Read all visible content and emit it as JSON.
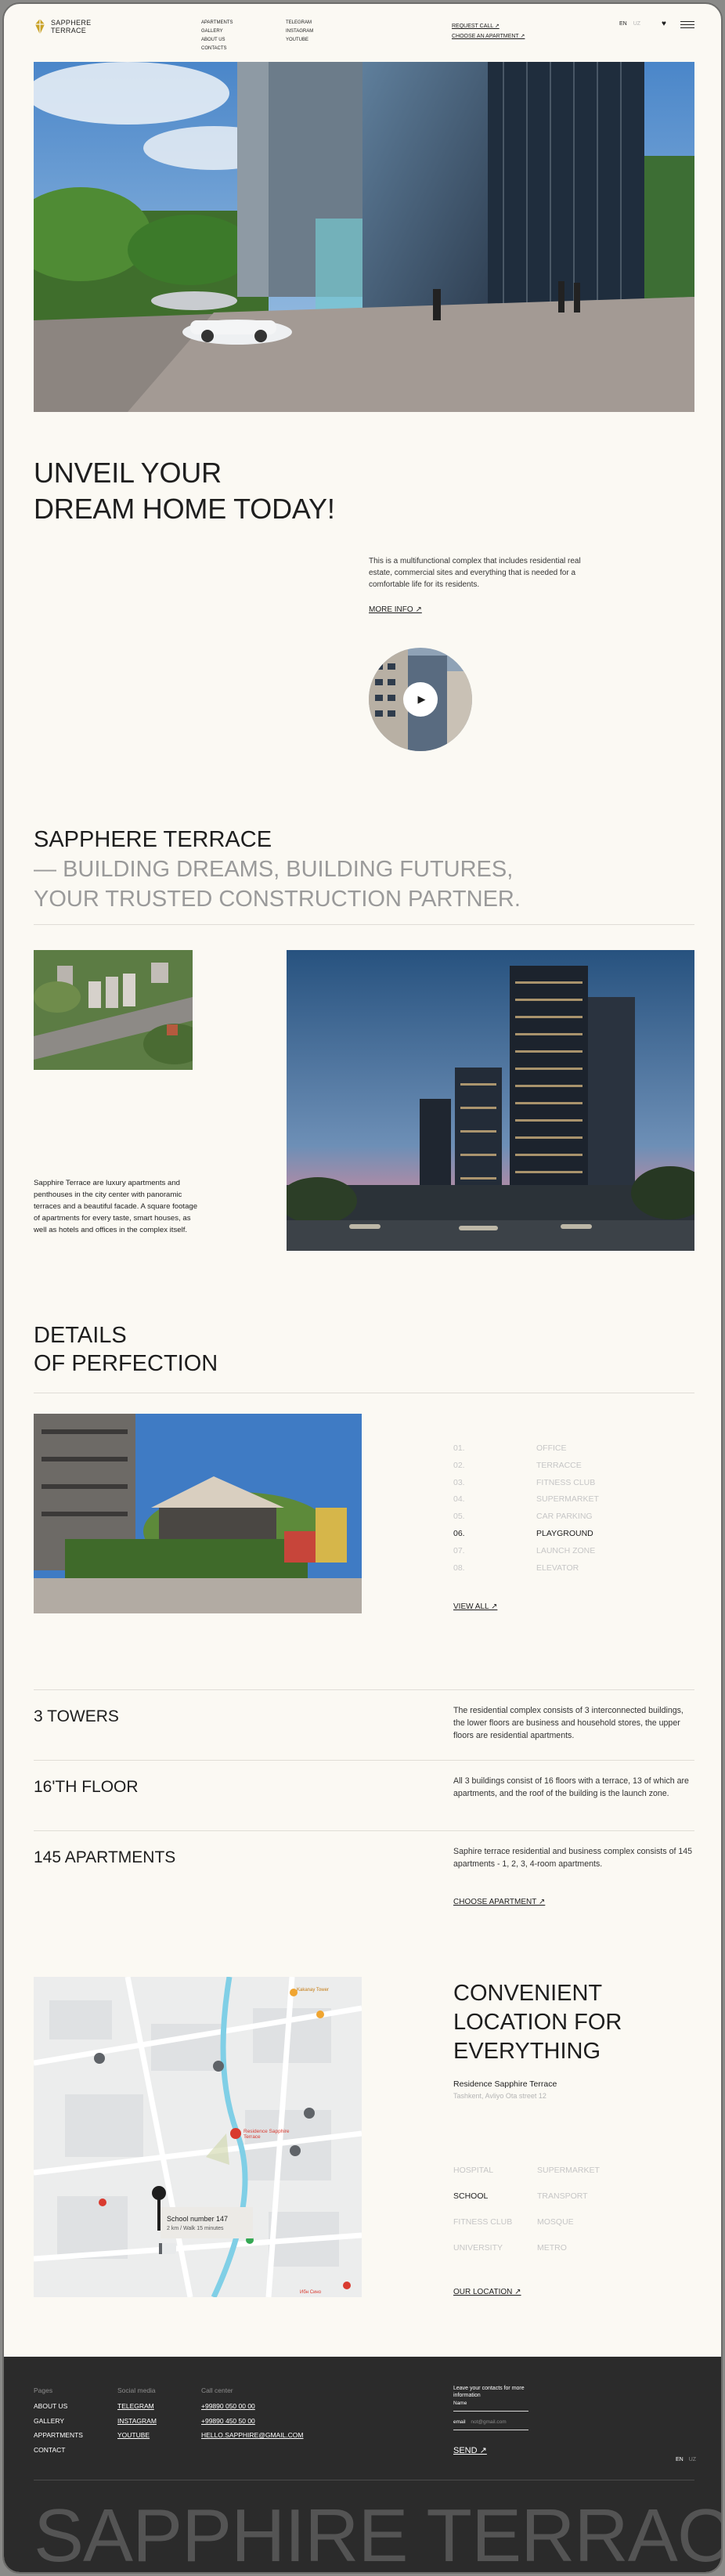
{
  "brand": {
    "line1": "SAPPHERE",
    "line2": "TERRACE"
  },
  "nav": {
    "col1": [
      "APARTMENTS",
      "GALLERY",
      "ABOUT US",
      "CONTACTS"
    ],
    "col2": [
      "TELEGRAM",
      "INSTAGRAM",
      "YOUTUBE"
    ],
    "col3": [
      "REQUEST CALL ↗",
      "CHOOSE AN APARTMENT ↗"
    ],
    "lang_active": "EN",
    "lang_other": "UZ"
  },
  "intro": {
    "title_line1": "UNVEIL YOUR",
    "title_line2": "DREAM HOME TODAY!",
    "text": "This is a multifunctional complex that includes residential real estate, commercial sites and everything that is needed for a comfortable life for its residents.",
    "more": "MORE INFO ↗"
  },
  "about": {
    "heading": "SAPPHERE TERRACE",
    "sub1": "BUILDING DREAMS, BUILDING FUTURES,",
    "sub2": "YOUR TRUSTED CONSTRUCTION PARTNER.",
    "text": "Sapphire Terrace are luxury apartments and penthouses in the city center with panoramic terraces and a beautiful facade. A square footage of apartments for every taste, smart houses, as well as hotels and offices in the complex itself."
  },
  "details": {
    "title_line1": "DETAILS",
    "title_line2": "OF PERFECTION",
    "items": [
      {
        "num": "01.",
        "label": "OFFICE"
      },
      {
        "num": "02.",
        "label": "TERRACCE"
      },
      {
        "num": "03.",
        "label": "FITNESS CLUB"
      },
      {
        "num": "04.",
        "label": "SUPERMARKET"
      },
      {
        "num": "05.",
        "label": "CAR PARKING"
      },
      {
        "num": "06.",
        "label": "PLAYGROUND"
      },
      {
        "num": "07.",
        "label": "LAUNCH ZONE"
      },
      {
        "num": "08.",
        "label": "ELEVATOR"
      }
    ],
    "active_index": 5,
    "view_all": "VIEW ALL ↗"
  },
  "stats": [
    {
      "key": "3 TOWERS",
      "value": "The residential complex consists of 3 interconnected buildings, the lower floors are business and household stores, the upper floors are residential apartments."
    },
    {
      "key": "16'TH FLOOR",
      "value": "All 3 buildings consist of 16 floors with a terrace, 13 of which are apartments, and the roof of the building is the launch zone."
    },
    {
      "key": "145 APARTMENTS",
      "value": "Saphire terrace residential and business complex consists of 145 apartments - 1, 2, 3, 4-room apartments."
    }
  ],
  "choose": "CHOOSE APARTMENT ↗",
  "location": {
    "title_line1": "CONVENIENT",
    "title_line2": "LOCATION FOR",
    "title_line3": "EVERYTHING",
    "address": "Residence Sapphire Terrace",
    "address_sub": "Tashkent, Avliyo Ota street 12",
    "places": [
      [
        "HOSPITAL",
        "SUPERMARKET"
      ],
      [
        "SCHOOL",
        "TRANSPORT"
      ],
      [
        "FITNESS CLUB",
        "MOSQUE"
      ],
      [
        "UNIVERSITY",
        "METRO"
      ]
    ],
    "active": "SCHOOL",
    "our_location": "OUR LOCATION ↗",
    "map_popup_title": "School number 147",
    "map_popup_sub": "2 km / Walk 15 minutes",
    "map_pin_label": "Residence Sapphire Terrace",
    "map_labels": [
      "Kakanay Tower",
      "Ибн Сино"
    ]
  },
  "footer": {
    "pages_title": "Pages",
    "pages": [
      "ABOUT US",
      "GALLERY",
      "APPARTMENTS",
      "CONTACT"
    ],
    "social_title": "Social media",
    "social": [
      "TELEGRAM",
      "INSTAGRAM",
      "YOUTUBE"
    ],
    "call_title": "Call center",
    "calls": [
      "+99890 050 00 00",
      "+99890 450 50 00",
      "HELLO.SAPPHIRE@GMAIL.COM"
    ],
    "contact_text": "Leave your contacts for more information",
    "name_label": "Name",
    "email_label": "email",
    "email_placeholder": "not@gmail.com",
    "send": "SEND ↗",
    "lang_active": "EN",
    "lang_other": "UZ",
    "big_word": "SAPPHIRE TERRACE"
  },
  "colors": {
    "accent": "#c9a227",
    "background": "#fbf9f3",
    "footer": "#2b2b2b"
  }
}
